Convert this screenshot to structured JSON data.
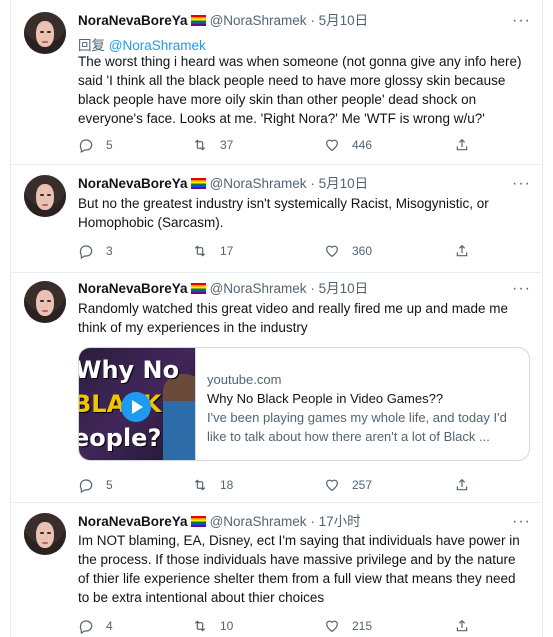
{
  "tweets": [
    {
      "name": "NoraNevaBoreYa",
      "handle": "@NoraShramek",
      "dot": "·",
      "time": "5月10日",
      "reply_prefix": "回复",
      "reply_to": "@NoraShramek",
      "text": "The worst thing i heard was when someone (not gonna give any info here) said 'I think all the black people need to have more glossy skin because black people have more oily skin than other people' dead shock on everyone's face. Looks at me. 'Right Nora?' Me 'WTF is wrong w/u?'",
      "replies": "5",
      "retweets": "37",
      "likes": "446"
    },
    {
      "name": "NoraNevaBoreYa",
      "handle": "@NoraShramek",
      "dot": "·",
      "time": "5月10日",
      "text": "But no the greatest industry isn't systemically Racist,  Misogynistic, or Homophobic (Sarcasm).",
      "replies": "3",
      "retweets": "17",
      "likes": "360"
    },
    {
      "name": "NoraNevaBoreYa",
      "handle": "@NoraShramek",
      "dot": "·",
      "time": "5月10日",
      "text": "Randomly watched this great video and really fired me up and made me think of my experiences in the industry",
      "card": {
        "thumb_lines": [
          "Why No",
          "BLACK",
          "eople?"
        ],
        "domain": "youtube.com",
        "title": "Why No Black People in Video Games??",
        "desc1": "I've been playing games my whole life, and today I'd",
        "desc2": "like to talk about how there aren't a lot of Black ..."
      },
      "replies": "5",
      "retweets": "18",
      "likes": "257"
    },
    {
      "name": "NoraNevaBoreYa",
      "handle": "@NoraShramek",
      "dot": "·",
      "time": "17小时",
      "text": "Im NOT blaming, EA, Disney, ect I'm saying that individuals have power in the process. If those individuals have massive privilege and by the nature of thier life experience shelter them from a full view that means they need to be extra intentional about thier choices",
      "replies": "4",
      "retweets": "10",
      "likes": "215"
    }
  ],
  "icons": {
    "reply": "reply-icon",
    "retweet": "retweet-icon",
    "like": "heart-icon",
    "share": "share-icon",
    "more": "more-icon",
    "flag": "rainbow-flag-icon",
    "play": "play-icon"
  },
  "colors": {
    "link": "#1d9bf0",
    "muted": "#536471",
    "text": "#0f1419",
    "border": "#cfd9de"
  }
}
